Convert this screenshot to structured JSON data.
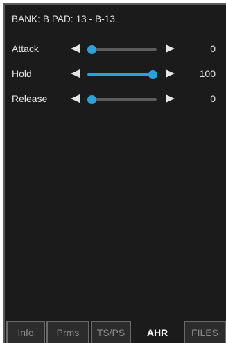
{
  "header": {
    "title": "BANK: B PAD: 13 - B-13"
  },
  "params": [
    {
      "label": "Attack",
      "value": "0",
      "level": 0
    },
    {
      "label": "Hold",
      "value": "100",
      "level": 100
    },
    {
      "label": "Release",
      "value": "0",
      "level": 0
    }
  ],
  "tabs": [
    {
      "label": "Info",
      "active": false
    },
    {
      "label": "Prms",
      "active": false
    },
    {
      "label": "TS/PS",
      "active": false
    },
    {
      "label": "AHR",
      "active": true
    },
    {
      "label": "FILES",
      "active": false
    }
  ],
  "colors": {
    "accent": "#2ea2d6",
    "background": "#1b1b1b",
    "text": "#e6e6e6"
  }
}
